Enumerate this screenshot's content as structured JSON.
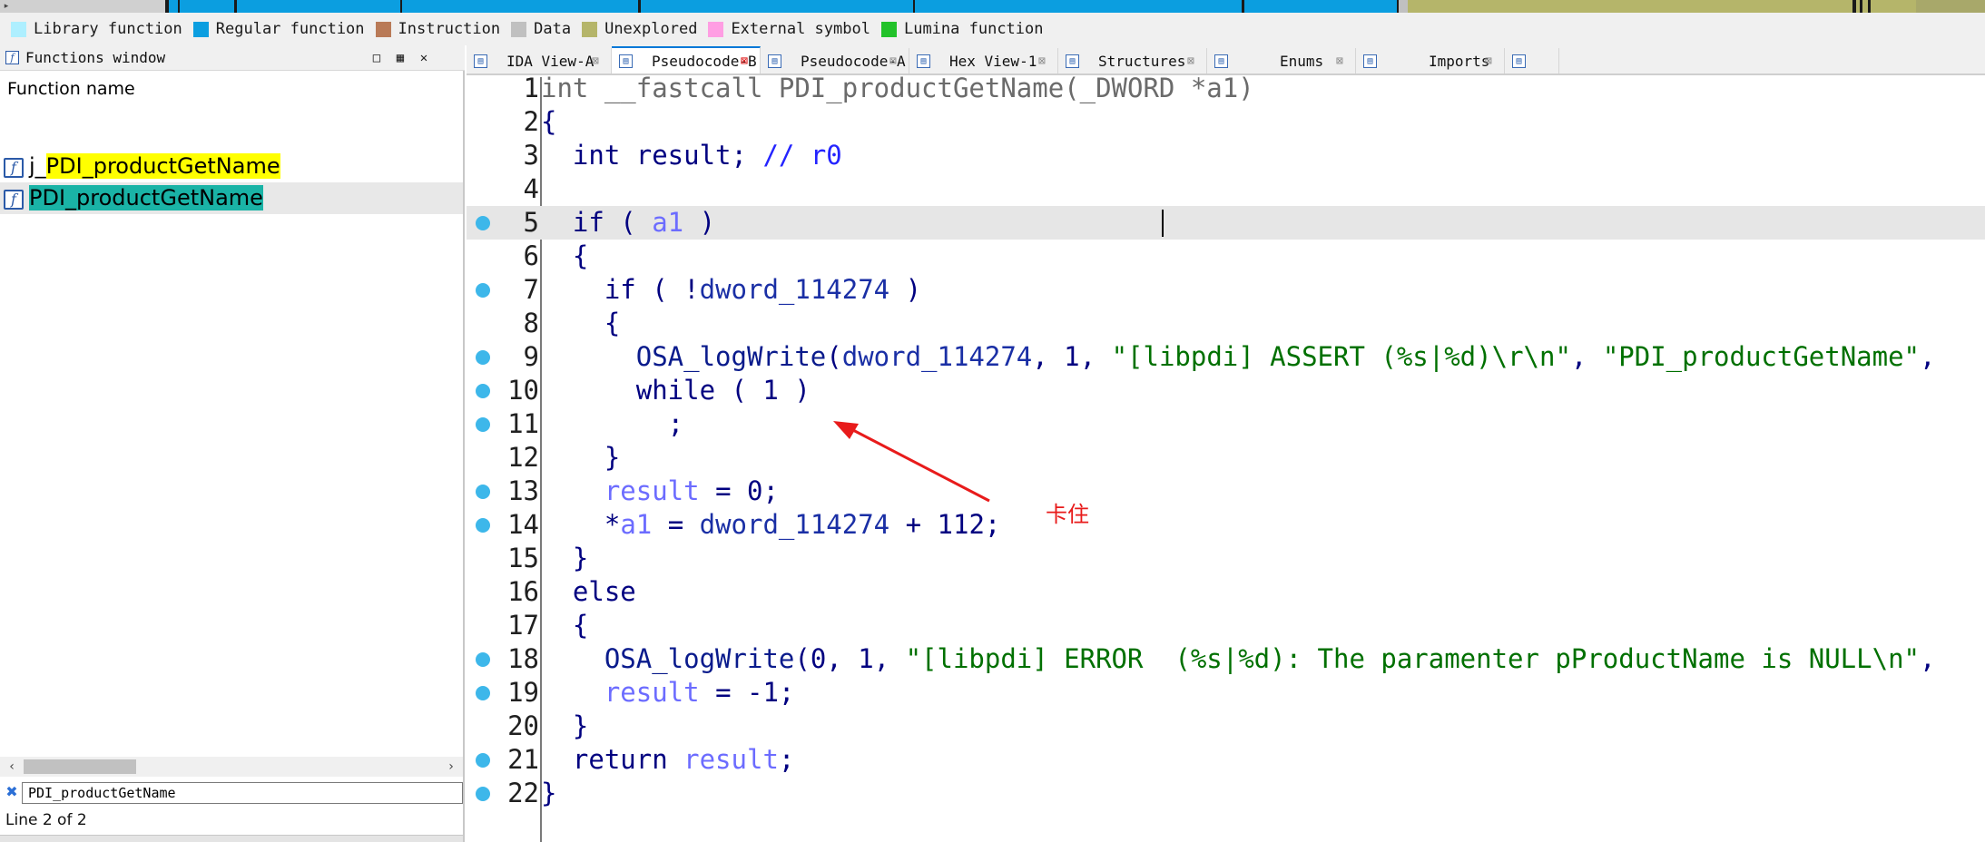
{
  "legend": [
    {
      "label": "Library function",
      "color": "#aeefff"
    },
    {
      "label": "Regular function",
      "color": "#0b9ee0"
    },
    {
      "label": "Instruction",
      "color": "#b97a57"
    },
    {
      "label": "Data",
      "color": "#c0c0c0"
    },
    {
      "label": "Unexplored",
      "color": "#b5b56a"
    },
    {
      "label": "External symbol",
      "color": "#ff9ee3"
    },
    {
      "label": "Lumina function",
      "color": "#22c22a"
    }
  ],
  "functions_window": {
    "title": "Functions window",
    "header": "Function name",
    "rows": [
      {
        "prefix": "j_",
        "name": "PDI_productGetName",
        "highlight": "#ffff00",
        "selected": false
      },
      {
        "prefix": "",
        "name": "PDI_productGetName",
        "highlight": "#1ab3a6",
        "selected": true
      }
    ],
    "search_value": "PDI_productGetName",
    "status": "Line 2 of 2"
  },
  "tabs": [
    {
      "label": "IDA View-A",
      "icon": "ida-view-icon",
      "active": false
    },
    {
      "label": "Pseudocode-B",
      "icon": "pseudocode-icon",
      "active": true
    },
    {
      "label": "Pseudocode-A",
      "icon": "pseudocode-icon",
      "active": false
    },
    {
      "label": "Hex View-1",
      "icon": "hex-view-icon",
      "active": false
    },
    {
      "label": "Structures",
      "icon": "structures-icon",
      "active": false
    },
    {
      "label": "Enums",
      "icon": "enums-icon",
      "active": false
    },
    {
      "label": "Imports",
      "icon": "imports-icon",
      "active": false
    }
  ],
  "code_lines": [
    {
      "num": "1",
      "dot": false,
      "tokens": [
        [
          "hd",
          "int __fastcall PDI_productGetName(_DWORD *a1)"
        ]
      ]
    },
    {
      "num": "2",
      "dot": false,
      "tokens": [
        [
          "pl",
          "{"
        ]
      ]
    },
    {
      "num": "3",
      "dot": false,
      "tokens": [
        [
          "pl",
          "  int result; "
        ],
        [
          "cm",
          "// r0"
        ]
      ]
    },
    {
      "num": "4",
      "dot": false,
      "tokens": []
    },
    {
      "num": "5",
      "dot": true,
      "current": true,
      "tokens": [
        [
          "pl",
          "  if ( "
        ],
        [
          "var",
          "a1"
        ],
        [
          "pl",
          " )"
        ]
      ]
    },
    {
      "num": "6",
      "dot": false,
      "tokens": [
        [
          "pl",
          "  {"
        ]
      ]
    },
    {
      "num": "7",
      "dot": true,
      "tokens": [
        [
          "pl",
          "    if ( !"
        ],
        [
          "gl",
          "dword_114274"
        ],
        [
          "pl",
          " )"
        ]
      ]
    },
    {
      "num": "8",
      "dot": false,
      "tokens": [
        [
          "pl",
          "    {"
        ]
      ]
    },
    {
      "num": "9",
      "dot": true,
      "tokens": [
        [
          "fn",
          "      OSA_logWrite"
        ],
        [
          "pl",
          "("
        ],
        [
          "gl",
          "dword_114274"
        ],
        [
          "pl",
          ", 1, "
        ],
        [
          "str",
          "\"[libpdi] ASSERT (%s|%d)\\r\\n\""
        ],
        [
          "pl",
          ", "
        ],
        [
          "str",
          "\"PDI_productGetName\""
        ],
        [
          "pl",
          ","
        ]
      ]
    },
    {
      "num": "10",
      "dot": true,
      "tokens": [
        [
          "pl",
          "      while ( 1 )"
        ]
      ]
    },
    {
      "num": "11",
      "dot": true,
      "tokens": [
        [
          "pl",
          "        ;"
        ]
      ]
    },
    {
      "num": "12",
      "dot": false,
      "tokens": [
        [
          "pl",
          "    }"
        ]
      ]
    },
    {
      "num": "13",
      "dot": true,
      "tokens": [
        [
          "var",
          "    result"
        ],
        [
          "pl",
          " = 0;"
        ]
      ]
    },
    {
      "num": "14",
      "dot": true,
      "tokens": [
        [
          "pl",
          "    *"
        ],
        [
          "var",
          "a1"
        ],
        [
          "pl",
          " = "
        ],
        [
          "gl",
          "dword_114274"
        ],
        [
          "pl",
          " + 112;"
        ]
      ]
    },
    {
      "num": "15",
      "dot": false,
      "tokens": [
        [
          "pl",
          "  }"
        ]
      ]
    },
    {
      "num": "16",
      "dot": false,
      "tokens": [
        [
          "pl",
          "  else"
        ]
      ]
    },
    {
      "num": "17",
      "dot": false,
      "tokens": [
        [
          "pl",
          "  {"
        ]
      ]
    },
    {
      "num": "18",
      "dot": true,
      "tokens": [
        [
          "fn",
          "    OSA_logWrite"
        ],
        [
          "pl",
          "(0, 1, "
        ],
        [
          "str",
          "\"[libpdi] ERROR  (%s|%d): The paramenter pProductName is NULL\\n\""
        ],
        [
          "pl",
          ","
        ]
      ]
    },
    {
      "num": "19",
      "dot": true,
      "tokens": [
        [
          "var",
          "    result"
        ],
        [
          "pl",
          " = -1;"
        ]
      ]
    },
    {
      "num": "20",
      "dot": false,
      "tokens": [
        [
          "pl",
          "  }"
        ]
      ]
    },
    {
      "num": "21",
      "dot": true,
      "tokens": [
        [
          "pl",
          "  return "
        ],
        [
          "var",
          "result"
        ],
        [
          "pl",
          ";"
        ]
      ]
    },
    {
      "num": "22",
      "dot": true,
      "tokens": [
        [
          "pl",
          "}"
        ]
      ]
    }
  ],
  "annotation": {
    "text": "卡住",
    "color": "#e81b1b"
  },
  "colors": {
    "breakpoint_dot": "#3db7ea",
    "current_line": "#e6e6e6",
    "accent": "#0078d7"
  }
}
